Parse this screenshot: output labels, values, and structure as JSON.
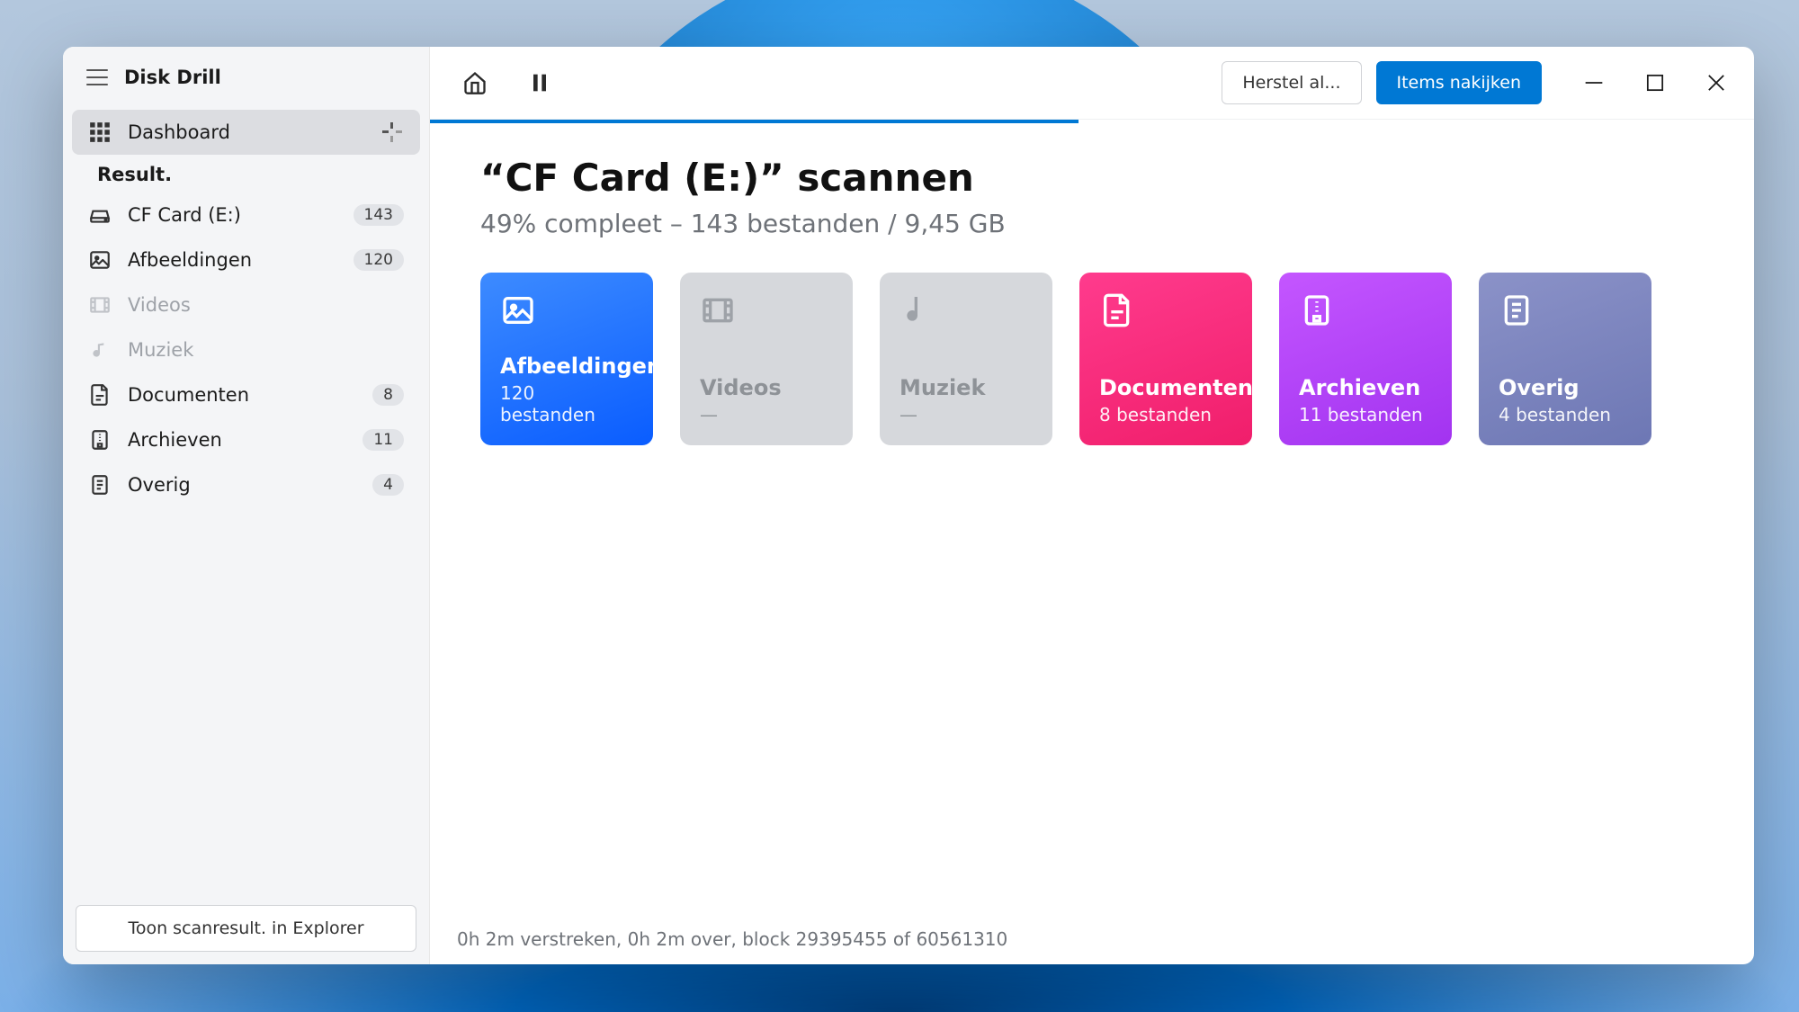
{
  "app": {
    "title": "Disk Drill"
  },
  "sidebar": {
    "dashboard": "Dashboard",
    "section": "Result.",
    "items": [
      {
        "label": "CF Card (E:)",
        "count": "143"
      },
      {
        "label": "Afbeeldingen",
        "count": "120"
      },
      {
        "label": "Videos",
        "count": ""
      },
      {
        "label": "Muziek",
        "count": ""
      },
      {
        "label": "Documenten",
        "count": "8"
      },
      {
        "label": "Archieven",
        "count": "11"
      },
      {
        "label": "Overig",
        "count": "4"
      }
    ],
    "footer_button": "Toon scanresult. in Explorer"
  },
  "toolbar": {
    "restore": "Herstel al...",
    "review": "Items nakijken"
  },
  "page": {
    "title": "“CF Card (E:)” scannen",
    "subtitle": "49% compleet – 143 bestanden / 9,45 GB"
  },
  "progress": {
    "percent": 49
  },
  "cards": [
    {
      "title": "Afbeeldingen",
      "sub": "120 bestanden"
    },
    {
      "title": "Videos",
      "sub": "—"
    },
    {
      "title": "Muziek",
      "sub": "—"
    },
    {
      "title": "Documenten",
      "sub": "8 bestanden"
    },
    {
      "title": "Archieven",
      "sub": "11 bestanden"
    },
    {
      "title": "Overig",
      "sub": "4 bestanden"
    }
  ],
  "status": "0h 2m verstreken, 0h 2m over, block 29395455 of 60561310"
}
